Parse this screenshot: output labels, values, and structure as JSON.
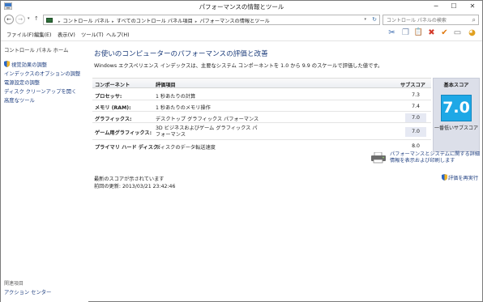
{
  "window": {
    "title": "パフォーマンスの情報とツール",
    "min": "─",
    "max": "☐",
    "close": "✕"
  },
  "nav": {
    "back": "←",
    "forward": "→",
    "dropdown": "▾",
    "up": "↑",
    "breadcrumbs": [
      "コントロール パネル",
      "すべてのコントロール パネル項目",
      "パフォーマンスの情報とツール"
    ],
    "separator": "▸",
    "refresh": "↻",
    "search_placeholder": "コントロール パネルの検索",
    "search_icon": "⌕"
  },
  "menubar": {
    "items": [
      "ファイル(F)",
      "編集(E)",
      "表示(V)",
      "ツール(T)",
      "ヘルプ(H)"
    ]
  },
  "toolbar": {
    "icons": [
      "scissors-icon",
      "copy-icon",
      "paste-icon",
      "delete-icon",
      "checkmark-icon",
      "window-icon",
      "help-icon"
    ],
    "glyphs": [
      "✂",
      "❐",
      "📋",
      "✖",
      "✔",
      "▭",
      "◕"
    ]
  },
  "sidebar": {
    "home": "コントロール パネル ホーム",
    "items": [
      "視覚効果の調整",
      "インデックスのオプションの調整",
      "電源設定の調整",
      "ディスク クリーンアップを開く",
      "高度なツール"
    ],
    "related_heading": "関連項目",
    "related_items": [
      "アクション センター"
    ]
  },
  "main": {
    "heading": "お使いのコンピューターのパフォーマンスの評価と改善",
    "description": "Windows エクスペリエンス インデックスは、主要なシステム コンポーネントを 1.0 から 9.9 のスケールで評価した値です。",
    "table": {
      "headers": [
        "コンポーネント",
        "評価項目",
        "サブスコア",
        "基本スコア"
      ],
      "rows": [
        {
          "component": "プロセッサ:",
          "rated": "1 秒あたりの計算",
          "subscore": "7.3"
        },
        {
          "component": "メモリ (RAM):",
          "rated": "1 秒あたりのメモリ操作",
          "subscore": "7.4"
        },
        {
          "component": "グラフィックス:",
          "rated": "デスクトップ グラフィックス パフォーマンス",
          "subscore": "7.0"
        },
        {
          "component": "ゲーム用グラフィックス:",
          "rated": "3D ビジネスおよびゲーム グラフィックス パフォーマンス",
          "subscore": "7.0"
        },
        {
          "component": "プライマリ ハード ディスク:",
          "rated": "ディスクのデータ転送速度",
          "subscore": "8.0"
        }
      ],
      "base_score": "7.0",
      "base_caption": "一番低いサブスコア"
    },
    "print_link": "パフォーマンスとシステムに関する詳細情報を表示および印刷します",
    "latest_text": "最新のスコアが示されています",
    "last_update": "前回の更新: 2013/03/21 23:42:46",
    "rerun_link": "評価を再実行"
  },
  "colors": {
    "badge": "#1ea8e6",
    "link": "#1f3f80",
    "heading": "#1e3e7c"
  }
}
